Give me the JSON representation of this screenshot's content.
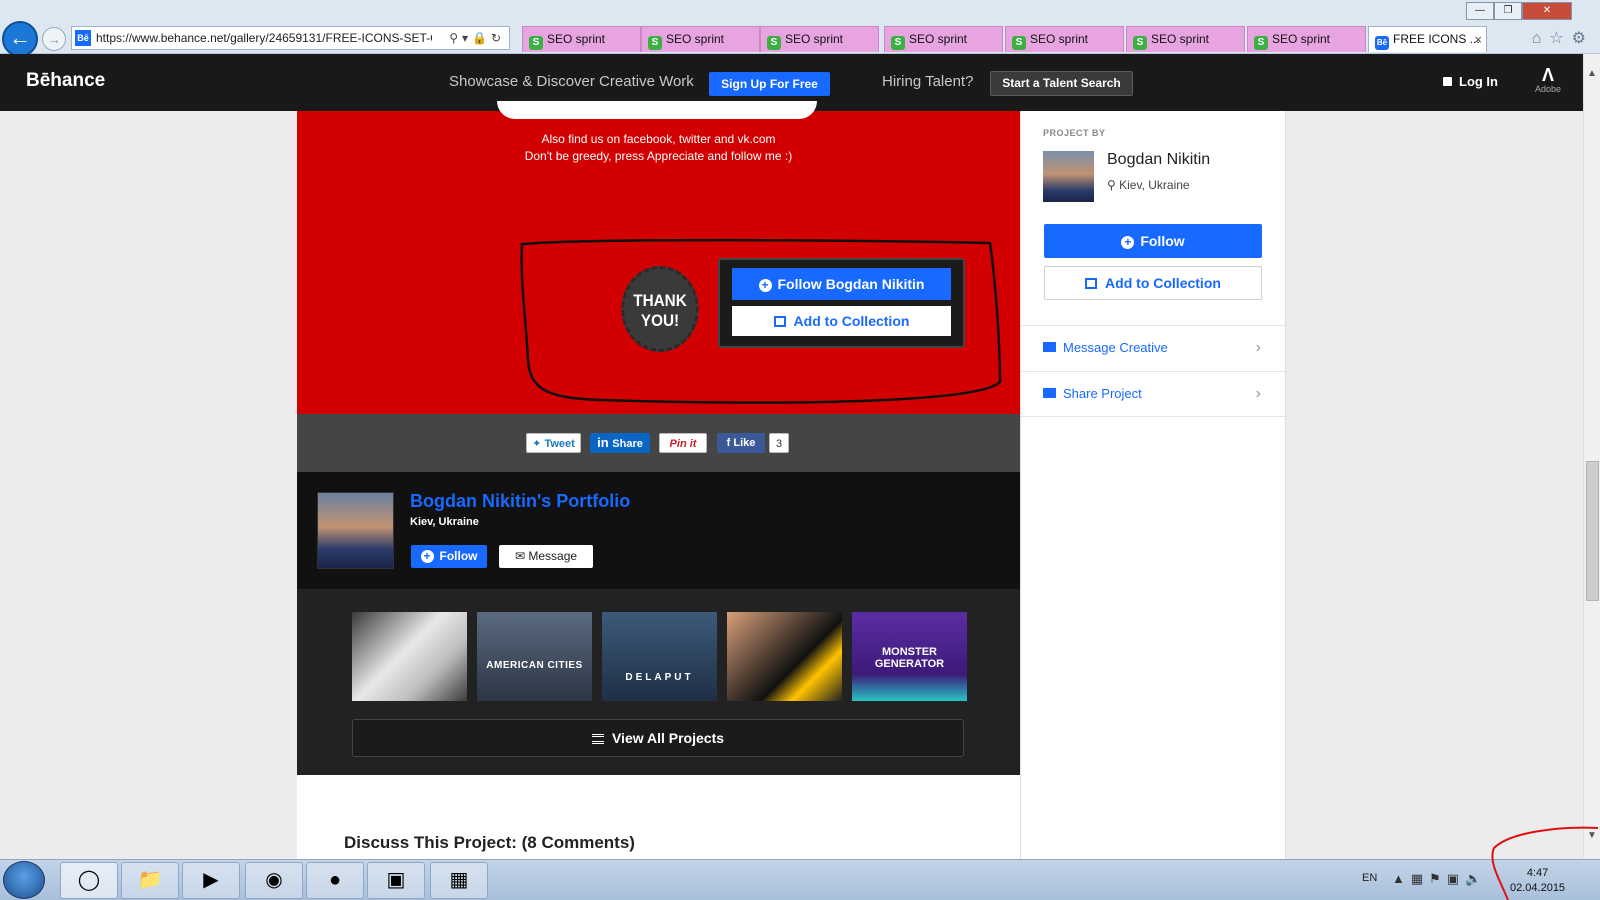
{
  "browser": {
    "url": "https://www.behance.net/gallery/24659131/FREE-ICONS-SET-Clo",
    "favicon": "Bē",
    "tabs": [
      {
        "label": "SEO sprint"
      },
      {
        "label": "SEO sprint"
      },
      {
        "label": "SEO sprint"
      },
      {
        "label": "SEO sprint"
      },
      {
        "label": "SEO sprint"
      },
      {
        "label": "SEO sprint"
      },
      {
        "label": "SEO sprint"
      }
    ],
    "active_tab": {
      "label": "FREE ICONS ...",
      "close": "×"
    }
  },
  "header": {
    "logo": "Bēhance",
    "tagline": "Showcase & Discover Creative Work",
    "signup": "Sign Up For Free",
    "hiring": "Hiring Talent?",
    "talent_search": "Start a Talent Search",
    "login": "Log In",
    "adobe": "Adobe"
  },
  "project": {
    "find_us": "Also find us on facebook, twitter and vk.com",
    "greedy": "Don't be greedy, press Appreciate and follow me :)",
    "thank_you_1": "THANK",
    "thank_you_2": "YOU!",
    "follow_owner": "Follow Bogdan Nikitin",
    "add_collection": "Add to Collection"
  },
  "share": {
    "tweet": "Tweet",
    "linkedin": "Share",
    "pinterest": "Pin it",
    "facebook": "Like",
    "like_count": "3"
  },
  "portfolio": {
    "name": "Bogdan Nikitin's Portfolio",
    "location": "Kiev, Ukraine",
    "follow": "Follow",
    "message": "Message",
    "thumbs": [
      {
        "label": ""
      },
      {
        "label": "AMERICAN CITIES"
      },
      {
        "label": "DELAPUT"
      },
      {
        "label": ""
      },
      {
        "label": "MONSTER GENERATOR"
      }
    ],
    "view_all": "View All Projects"
  },
  "discuss": "Discuss This Project: (8 Comments)",
  "sidebar": {
    "project_by": "PROJECT BY",
    "owner_name": "Bogdan Nikitin",
    "owner_location": "Kiev, Ukraine",
    "follow": "Follow",
    "add_collection": "Add to Collection",
    "message": "Message Creative",
    "share": "Share Project"
  },
  "taskbar": {
    "lang": "EN",
    "time": "4:47",
    "date": "02.04.2015"
  },
  "colors": {
    "behance_blue": "#1769ff",
    "project_red": "#d20000",
    "annotation_black": "#111111",
    "annotation_red": "#e01010"
  }
}
